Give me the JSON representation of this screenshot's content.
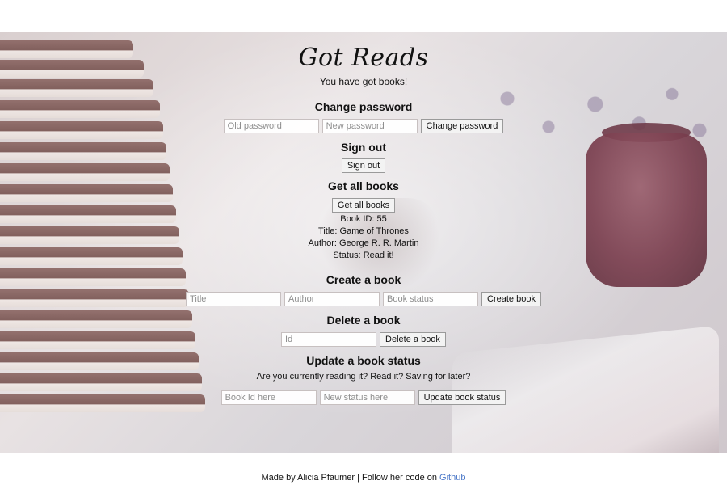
{
  "app": {
    "title": "Got Reads",
    "tagline": "You have got books!"
  },
  "sections": {
    "change_password": {
      "heading": "Change password",
      "old_placeholder": "Old password",
      "new_placeholder": "New password",
      "button": "Change password"
    },
    "sign_out": {
      "heading": "Sign out",
      "button": "Sign out"
    },
    "get_all_books": {
      "heading": "Get all books",
      "button": "Get all books",
      "book": {
        "id_line": "Book ID: 55",
        "title_line": "Title: Game of Thrones",
        "author_line": "Author: George R. R. Martin",
        "status_line": "Status: Read it!"
      }
    },
    "create_book": {
      "heading": "Create a book",
      "title_placeholder": "Title",
      "author_placeholder": "Author",
      "status_placeholder": "Book status",
      "button": "Create book"
    },
    "delete_book": {
      "heading": "Delete a book",
      "id_placeholder": "Id",
      "button": "Delete a book"
    },
    "update_status": {
      "heading": "Update a book status",
      "note": "Are you currently reading it? Read it? Saving for later?",
      "id_placeholder": "Book Id here",
      "status_placeholder": "New status here",
      "button": "Update book status"
    }
  },
  "footer": {
    "text": "Made by Alicia Pfaumer | Follow her code on",
    "link_text": "Github"
  },
  "colors": {
    "link": "#4b78c8"
  }
}
